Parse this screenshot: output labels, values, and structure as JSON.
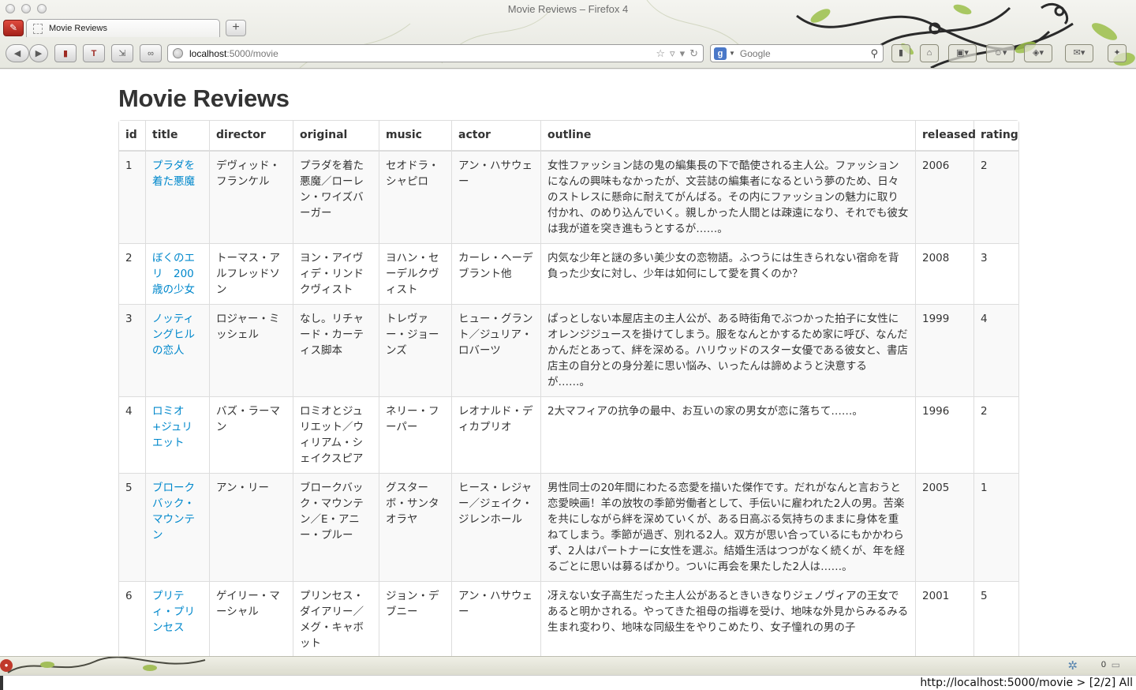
{
  "window": {
    "title": "Movie Reviews – Firefox 4"
  },
  "tab": {
    "label": "Movie Reviews"
  },
  "navbar": {
    "url_host": "localhost",
    "url_path": ":5000/movie",
    "search_engine": "Google",
    "search_placeholder": "Google"
  },
  "page": {
    "title": "Movie Reviews",
    "columns": [
      "id",
      "title",
      "director",
      "original",
      "music",
      "actor",
      "outline",
      "released",
      "rating"
    ],
    "rows": [
      {
        "id": "1",
        "title": "プラダを着た悪魔",
        "director": "デヴィッド・フランケル",
        "original": "プラダを着た悪魔／ローレン・ワイズバーガー",
        "music": "セオドラ・シャピロ",
        "actor": "アン・ハサウェー",
        "outline": "女性ファッション誌の鬼の編集長の下で酷使される主人公。ファッションになんの興味もなかったが、文芸誌の編集者になるという夢のため、日々のストレスに懸命に耐えてがんばる。その内にファッションの魅力に取り付かれ、のめり込んでいく。親しかった人間とは疎遠になり、それでも彼女は我が道を突き進もうとするが……。",
        "released": "2006",
        "rating": "2"
      },
      {
        "id": "2",
        "title": "ぼくのエリ　200歳の少女",
        "director": "トーマス・アルフレッドソン",
        "original": "ヨン・アイヴィデ・リンドクヴィスト",
        "music": "ヨハン・セーデルクヴィスト",
        "actor": "カーレ・ヘーデブラント他",
        "outline": "内気な少年と謎の多い美少女の恋物語。ふつうには生きられない宿命を背負った少女に対し、少年は如何にして愛を貫くのか？",
        "released": "2008",
        "rating": "3"
      },
      {
        "id": "3",
        "title": "ノッティングヒルの恋人",
        "director": "ロジャー・ミッシェル",
        "original": "なし。リチャード・カーティス脚本",
        "music": "トレヴァー・ジョーンズ",
        "actor": "ヒュー・グラント／ジュリア・ロバーツ",
        "outline": "ぱっとしない本屋店主の主人公が、ある時街角でぶつかった拍子に女性にオレンジジュースを掛けてしまう。服をなんとかするため家に呼び、なんだかんだとあって、絆を深める。ハリウッドのスター女優である彼女と、書店店主の自分との身分差に思い悩み、いったんは諦めようと決意するが……。",
        "released": "1999",
        "rating": "4"
      },
      {
        "id": "4",
        "title": "ロミオ+ジュリエット",
        "director": "バズ・ラーマン",
        "original": "ロミオとジュリエット／ウィリアム・シェイクスピア",
        "music": "ネリー・フーパー",
        "actor": "レオナルド・ディカプリオ",
        "outline": "2大マフィアの抗争の最中、お互いの家の男女が恋に落ちて……。",
        "released": "1996",
        "rating": "2"
      },
      {
        "id": "5",
        "title": "ブロークバック・マウンテン",
        "director": "アン・リー",
        "original": "ブロークバック・マウンテン／E・アニー・プルー",
        "music": "グスターボ・サンタオラヤ",
        "actor": "ヒース・レジャー／ジェイク・ジレンホール",
        "outline": "男性同士の20年間にわたる恋愛を描いた傑作です。だれがなんと言おうと恋愛映画！羊の放牧の季節労働者として、手伝いに雇われた2人の男。苦楽を共にしながら絆を深めていくが、ある日高ぶる気持ちのままに身体を重ねてしまう。季節が過ぎ、別れる2人。双方が思い合っているにもかかわらず、2人はパートナーに女性を選ぶ。結婚生活はつつがなく続くが、年を経るごとに思いは募るばかり。ついに再会を果たした2人は……。",
        "released": "2005",
        "rating": "1"
      },
      {
        "id": "6",
        "title": "プリティ・プリンセス",
        "director": "ゲイリー・マーシャル",
        "original": "プリンセス・ダイアリー／メグ・キャボット",
        "music": "ジョン・デブニー",
        "actor": "アン・ハサウェー",
        "outline": "冴えない女子高生だった主人公があるときいきなりジェノヴィアの王女であると明かされる。やってきた祖母の指導を受け、地味な外見からみるみる生まれ変わり、地味な同級生をやりこめたり、女子憧れの男の子",
        "released": "2001",
        "rating": "5"
      }
    ]
  },
  "addonbar": {
    "count": "0"
  },
  "statusbar": {
    "text": "http://localhost:5000/movie > [2/2] All"
  },
  "icons": {
    "back": "back-arrow-icon",
    "forward": "forward-arrow-icon",
    "reload": "reload-icon",
    "bookmark_star": "bookmark-star-icon",
    "search": "search-icon",
    "globe": "site-identity-icon"
  },
  "colors": {
    "link": "#0088cc",
    "border": "#dddddd",
    "stripe": "#f9f9f9",
    "text": "#333333"
  }
}
